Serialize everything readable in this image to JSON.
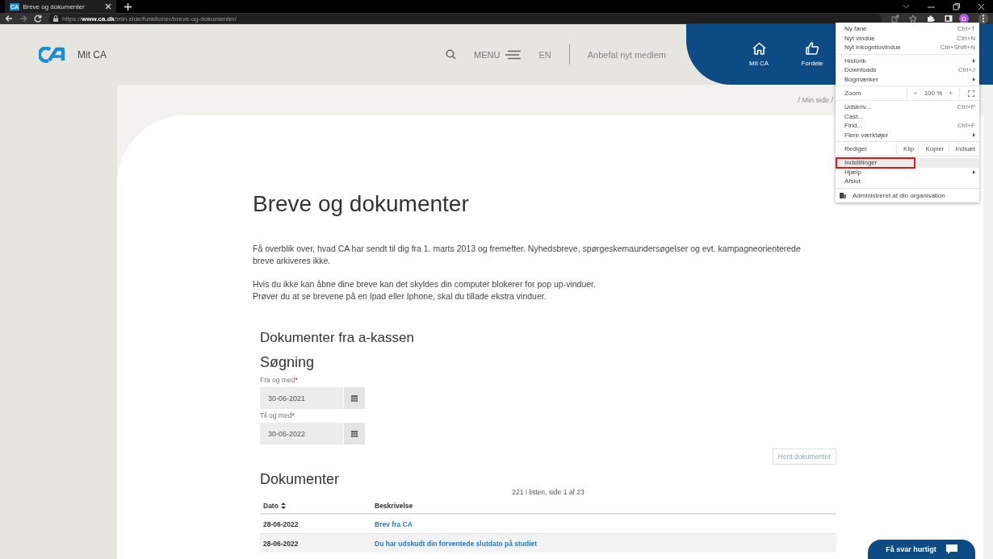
{
  "browser": {
    "tab_title": "Breve og dokumenter",
    "favicon": "CA",
    "url": "https://**www.ca.dk**/min-side/funktioner/breve-og-dokumenter/",
    "avatar": "D"
  },
  "header": {
    "site_name": "Mit CA",
    "menu_label": "MENU",
    "language": "EN",
    "recommend": "Anbefal nyt medlem",
    "nav": [
      {
        "kind": "home",
        "label": "Mit CA"
      },
      {
        "kind": "thumb",
        "label": "Fordele"
      }
    ]
  },
  "breadcrumb": "/ Min side /",
  "page": {
    "title": "Breve og dokumenter",
    "paragraphs": [
      [
        "Få overblik over, hvad CA har sendt til dig fra 1. marts 2013 og fremefter. Nyhedsbreve, spørgeskemaundersøgelser og evt. kampagneorienterede breve arkiveres ikke."
      ],
      [
        "Hvis du ikke kan åbne dine breve kan det skyldes din computer blokerer for pop up-vinduer.",
        "Prøver du at se brevene på en Ipad eller Iphone, skal du tillade ekstra vinduer."
      ]
    ],
    "section_title": "Dokumenter fra a-kassen",
    "search_title": "Søgning",
    "fields": [
      {
        "label": "Fra og med",
        "required_marker": "*",
        "value": "30-06-2021"
      },
      {
        "label": "Til og med",
        "required_marker": "*",
        "value": "30-06-2022"
      }
    ],
    "fetch_button": "Hent dokumenter",
    "documents_title": "Dokumenter",
    "count": "221 i listen, side 1 af 23",
    "table": {
      "columns": [
        {
          "label": "Dato",
          "sortable": true
        },
        {
          "label": "Beskrivelse",
          "sortable": false
        }
      ],
      "rows": [
        {
          "date": "28-06-2022",
          "description": "Brev fra CA"
        },
        {
          "date": "28-06-2022",
          "description": "Du har udskudt din forventede slutdato på studiet"
        }
      ]
    }
  },
  "chat_button": "Få svar hurtigt",
  "browser_menu": [
    {
      "kind": "item",
      "label": "Ny fane",
      "shortcut": "Ctrl+T",
      "submenu": false,
      "selected": false
    },
    {
      "kind": "item",
      "label": "Nyt vindue",
      "shortcut": "Ctrl+N",
      "submenu": false,
      "selected": false
    },
    {
      "kind": "item",
      "label": "Nyt inkognitovindue",
      "shortcut": "Ctrl+Shift+N",
      "submenu": false,
      "selected": false
    },
    {
      "kind": "separator"
    },
    {
      "kind": "item",
      "label": "Historik",
      "submenu": true,
      "selected": false
    },
    {
      "kind": "item",
      "label": "Downloads",
      "shortcut": "Ctrl+J",
      "submenu": false,
      "selected": false
    },
    {
      "kind": "item",
      "label": "Bogmærker",
      "submenu": true,
      "selected": false
    },
    {
      "kind": "separator"
    },
    {
      "kind": "zoom",
      "label": "Zoom",
      "minus": "−",
      "value": "100 %",
      "plus": "+"
    },
    {
      "kind": "separator"
    },
    {
      "kind": "item",
      "label": "Udskriv...",
      "shortcut": "Ctrl+P",
      "submenu": false,
      "selected": false
    },
    {
      "kind": "item",
      "label": "Cast...",
      "submenu": false,
      "selected": false
    },
    {
      "kind": "item",
      "label": "Find...",
      "shortcut": "Ctrl+F",
      "submenu": false,
      "selected": false
    },
    {
      "kind": "item",
      "label": "Flere værktøjer",
      "submenu": true,
      "selected": false
    },
    {
      "kind": "separator"
    },
    {
      "kind": "edit",
      "label": "Rediger",
      "actions": [
        "Klip",
        "Kopier",
        "Indsæt"
      ]
    },
    {
      "kind": "separator"
    },
    {
      "kind": "item",
      "label": "Indstillinger",
      "submenu": false,
      "selected": true
    },
    {
      "kind": "item",
      "label": "Hjælp",
      "submenu": true,
      "selected": false
    },
    {
      "kind": "item",
      "label": "Afslut",
      "submenu": false,
      "selected": false
    },
    {
      "kind": "separator"
    },
    {
      "kind": "managed",
      "label": "Administreret af din organisation"
    }
  ]
}
